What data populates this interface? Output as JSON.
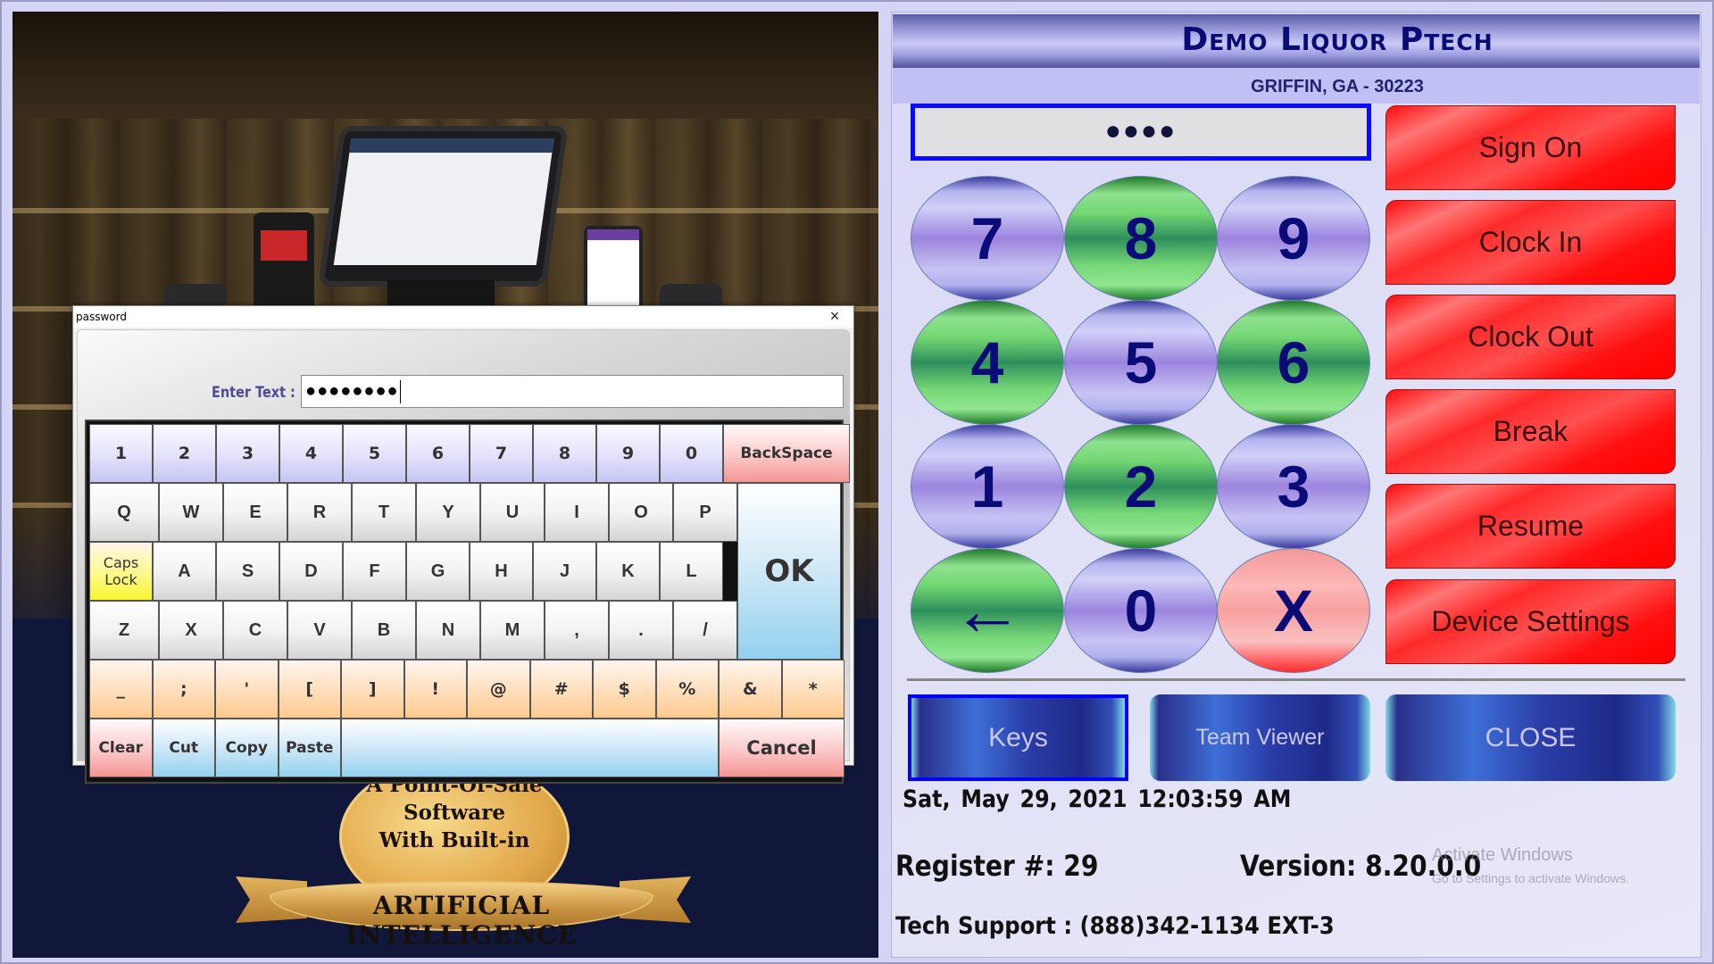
{
  "left_panel": {
    "badge": {
      "lines": [
        "A Point-Of-Sale",
        "Software",
        "With Built-in"
      ],
      "ribbon": "ARTIFICIAL INTELLIGENCE"
    }
  },
  "dialog": {
    "title": "password",
    "close_icon": "×",
    "enter_label": "Enter Text :",
    "enter_value": "●●●●●●●●",
    "keyboard": {
      "row1": [
        "1",
        "2",
        "3",
        "4",
        "5",
        "6",
        "7",
        "8",
        "9",
        "0"
      ],
      "backspace": "BackSpace",
      "row2": [
        "Q",
        "W",
        "E",
        "R",
        "T",
        "Y",
        "U",
        "I",
        "O",
        "P"
      ],
      "caps_lock": [
        "Caps",
        "Lock"
      ],
      "row3": [
        "A",
        "S",
        "D",
        "F",
        "G",
        "H",
        "J",
        "K",
        "L"
      ],
      "row4": [
        "Z",
        "X",
        "C",
        "V",
        "B",
        "N",
        "M",
        ",",
        ".",
        "/"
      ],
      "ok": "OK",
      "row5": [
        "_",
        ";",
        "'",
        "[",
        "]",
        "!",
        "@",
        "#",
        "$",
        "%",
        "&",
        "*"
      ],
      "clear": "Clear",
      "cut": "Cut",
      "copy": "Copy",
      "paste": "Paste",
      "space": "",
      "cancel": "Cancel"
    }
  },
  "right_panel": {
    "store_name": "Demo Liquor Ptech",
    "store_address": "GRIFFIN, GA - 30223",
    "pin_display": "●●●●",
    "numpad": [
      {
        "label": "7",
        "style": "purple"
      },
      {
        "label": "8",
        "style": "green"
      },
      {
        "label": "9",
        "style": "purple"
      },
      {
        "label": "4",
        "style": "green"
      },
      {
        "label": "5",
        "style": "purple"
      },
      {
        "label": "6",
        "style": "green"
      },
      {
        "label": "1",
        "style": "purple"
      },
      {
        "label": "2",
        "style": "green"
      },
      {
        "label": "3",
        "style": "purple"
      },
      {
        "label": "←",
        "style": "green",
        "icon": "arrow-left-icon"
      },
      {
        "label": "0",
        "style": "purple"
      },
      {
        "label": "X",
        "style": "red"
      }
    ],
    "actions": [
      "Sign On",
      "Clock In",
      "Clock Out",
      "Break",
      "Resume",
      "Device Settings"
    ],
    "bottom_buttons": {
      "keys": "Keys",
      "team_viewer": "Team Viewer",
      "close": "CLOSE"
    },
    "date": "Sat, May 29, 2021",
    "time": "12:03:59 AM",
    "register": "Register #: 29",
    "version": "Version: 8.20.0.0",
    "tech_support": "Tech Support : (888)342-1134 EXT-3",
    "watermark": {
      "title": "Activate Windows",
      "subtitle": "Go to Settings to activate Windows."
    }
  }
}
